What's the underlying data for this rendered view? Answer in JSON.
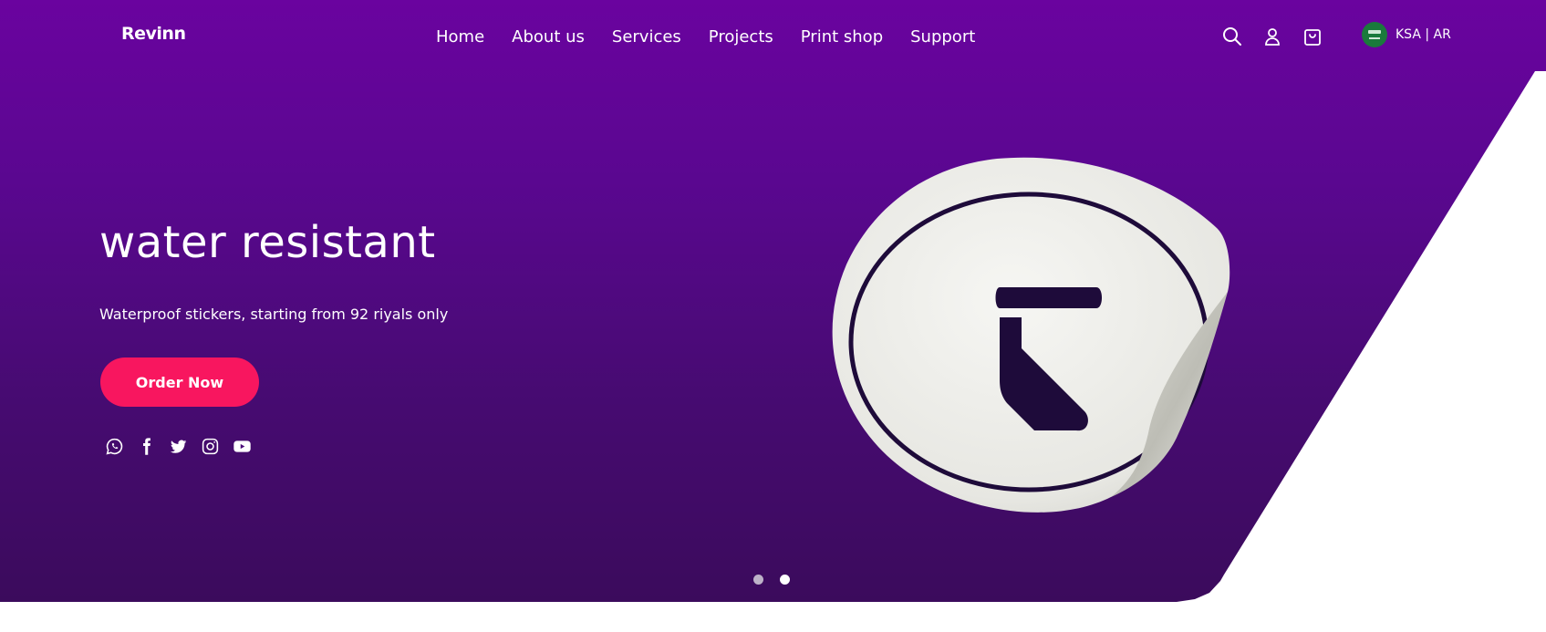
{
  "brand": {
    "logo_text": "Revinn"
  },
  "nav": {
    "links": [
      "Home",
      "About us",
      "Services",
      "Projects",
      "Print shop",
      "Support"
    ]
  },
  "header_icons": [
    "search-icon",
    "account-icon",
    "cart-icon"
  ],
  "locale": {
    "label": "KSA | AR",
    "flag": "saudi-flag-icon"
  },
  "hero": {
    "title": "water resistant",
    "subtitle": "Waterproof stickers, starting from 92 riyals only",
    "cta_label": "Order Now"
  },
  "socials": [
    "whatsapp-icon",
    "facebook-icon",
    "twitter-icon",
    "instagram-icon",
    "youtube-icon"
  ],
  "carousel": {
    "slide_count": 2,
    "active_index": 1
  },
  "colors": {
    "hero_top": "#6a039f",
    "hero_bottom": "#3b0b5c",
    "cta": "#f8165f",
    "sticker_mark": "#1e0b3a"
  }
}
